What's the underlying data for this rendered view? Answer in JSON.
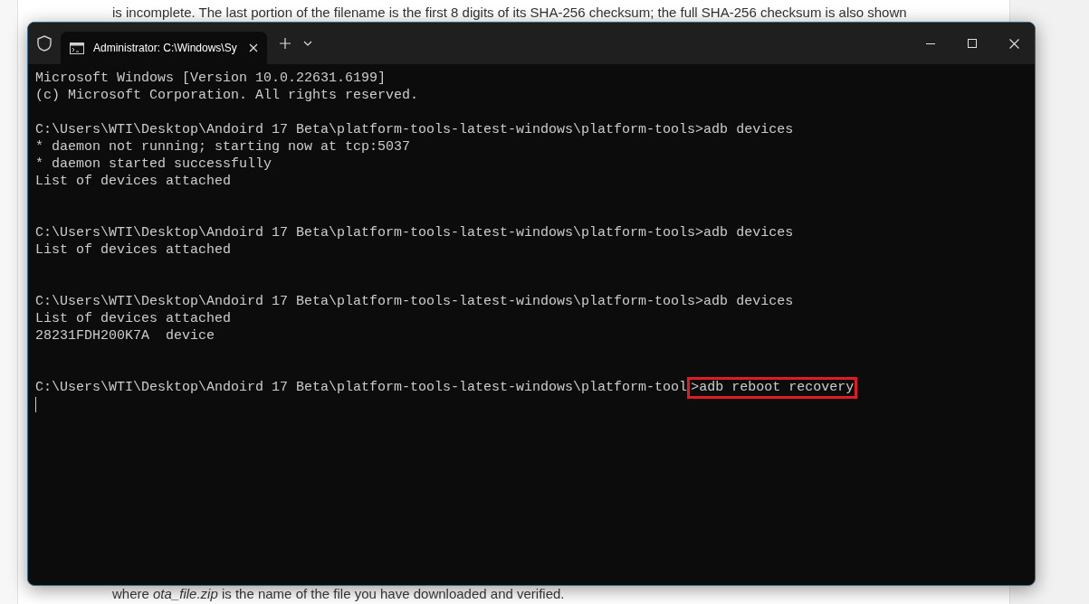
{
  "article": {
    "top_text": "is incomplete. The last portion of the filename is the first 8 digits of its SHA-256 checksum; the full SHA-256 checksum is also shown",
    "bottom_text": "where *ota_file.zip* is the name of the file you have downloaded and verified."
  },
  "window": {
    "tab": {
      "title": "Administrator: C:\\Windows\\Sy",
      "selected": true
    }
  },
  "terminal": {
    "lines": [
      {
        "kind": "text",
        "text": "Microsoft Windows [Version 10.0.22631.6199]"
      },
      {
        "kind": "text",
        "text": "(c) Microsoft Corporation. All rights reserved."
      },
      {
        "kind": "blank"
      },
      {
        "kind": "text",
        "text": "C:\\Users\\WTI\\Desktop\\Andoird 17 Beta\\platform-tools-latest-windows\\platform-tools>adb devices"
      },
      {
        "kind": "text",
        "text": "* daemon not running; starting now at tcp:5037"
      },
      {
        "kind": "text",
        "text": "* daemon started successfully"
      },
      {
        "kind": "text",
        "text": "List of devices attached"
      },
      {
        "kind": "blank"
      },
      {
        "kind": "blank"
      },
      {
        "kind": "text",
        "text": "C:\\Users\\WTI\\Desktop\\Andoird 17 Beta\\platform-tools-latest-windows\\platform-tools>adb devices"
      },
      {
        "kind": "text",
        "text": "List of devices attached"
      },
      {
        "kind": "blank"
      },
      {
        "kind": "blank"
      },
      {
        "kind": "text",
        "text": "C:\\Users\\WTI\\Desktop\\Andoird 17 Beta\\platform-tools-latest-windows\\platform-tools>adb devices"
      },
      {
        "kind": "text",
        "text": "List of devices attached"
      },
      {
        "kind": "text",
        "text": "28231FDH200K7A  device"
      },
      {
        "kind": "blank"
      },
      {
        "kind": "blank"
      },
      {
        "kind": "highlighted",
        "text": "C:\\Users\\WTI\\Desktop\\Andoird 17 Beta\\platform-tools-latest-windows\\platform-tool",
        "highlight": ">adb reboot recovery"
      },
      {
        "kind": "cursor"
      }
    ]
  }
}
